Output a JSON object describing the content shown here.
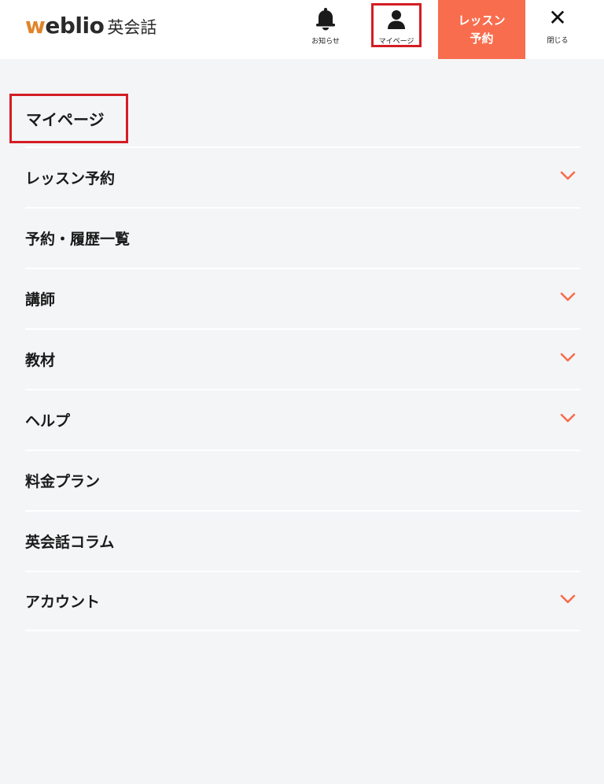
{
  "header": {
    "logo_main_first": "w",
    "logo_main_rest": "eblio",
    "logo_sub": "英会話",
    "notice_label": "お知らせ",
    "mypage_label": "マイページ",
    "reserve_line1": "レッスン",
    "reserve_line2": "予約",
    "close_symbol": "✕",
    "close_label": "閉じる"
  },
  "menu": {
    "title": "マイページ",
    "items": [
      {
        "label": "レッスン予約",
        "expandable": true
      },
      {
        "label": "予約・履歴一覧",
        "expandable": false
      },
      {
        "label": "講師",
        "expandable": true
      },
      {
        "label": "教材",
        "expandable": true
      },
      {
        "label": "ヘルプ",
        "expandable": true
      },
      {
        "label": "料金プラン",
        "expandable": false
      },
      {
        "label": "英会話コラム",
        "expandable": false
      },
      {
        "label": "アカウント",
        "expandable": true
      }
    ]
  },
  "colors": {
    "accent": "#f86d4d",
    "highlight_border": "#d31e24",
    "logo_w": "#e0842a",
    "background": "#f4f5f7"
  },
  "icons": {
    "notice": "bell-icon",
    "mypage": "user-icon",
    "close": "close-icon",
    "expand": "chevron-down-icon"
  }
}
